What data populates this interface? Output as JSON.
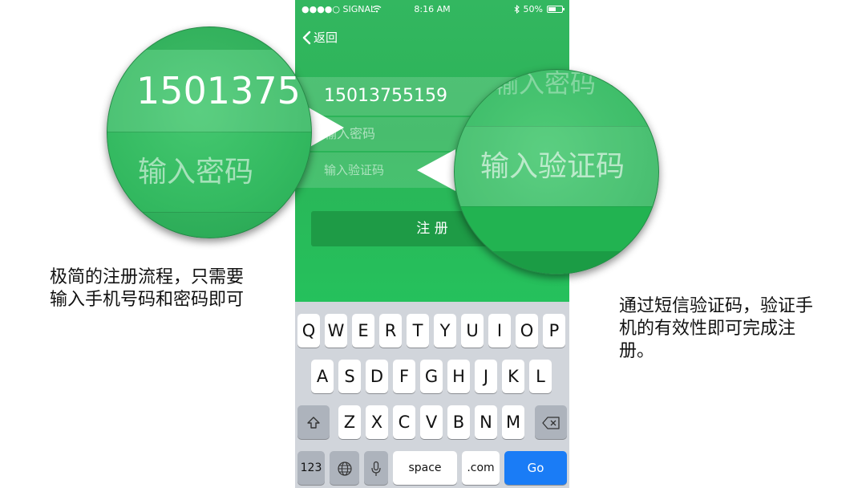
{
  "status_bar": {
    "signal": "●●●●○ SIGNAL",
    "wifi_icon": "wifi-icon",
    "time": "8:16 AM",
    "bluetooth_icon": "bluetooth-icon",
    "battery": "50%"
  },
  "nav": {
    "back_label": "返回"
  },
  "form": {
    "phone_value": "15013755159",
    "password_placeholder": "输入密码",
    "code_placeholder": "输入验证码",
    "register_label": "注 册"
  },
  "keyboard": {
    "row1": [
      "Q",
      "W",
      "E",
      "R",
      "T",
      "Y",
      "U",
      "I",
      "O",
      "P"
    ],
    "row2": [
      "A",
      "S",
      "D",
      "F",
      "G",
      "H",
      "J",
      "K",
      "L"
    ],
    "row3": [
      "Z",
      "X",
      "C",
      "V",
      "B",
      "N",
      "M"
    ],
    "shift_icon": "shift-icon",
    "delete_icon": "delete-icon",
    "numbers_label": "123",
    "globe_icon": "globe-icon",
    "mic_icon": "microphone-icon",
    "space_label": "space",
    "dotcom_label": ".com",
    "go_label": "Go"
  },
  "magnifier_left": {
    "phone_text": "1501375",
    "password_text": "输入密码"
  },
  "magnifier_right": {
    "password_text": "输入密码",
    "code_text": "输入验证码"
  },
  "captions": {
    "left": "极简的注册流程，只需要输入手机号码和密码即可",
    "right": "通过短信验证码，验证手机的有效性即可完成注册。"
  },
  "colors": {
    "primary_green": "#2bb357",
    "button_green": "#1e9b46",
    "go_blue": "#1a7cf6",
    "keyboard_bg": "#d1d5db"
  }
}
